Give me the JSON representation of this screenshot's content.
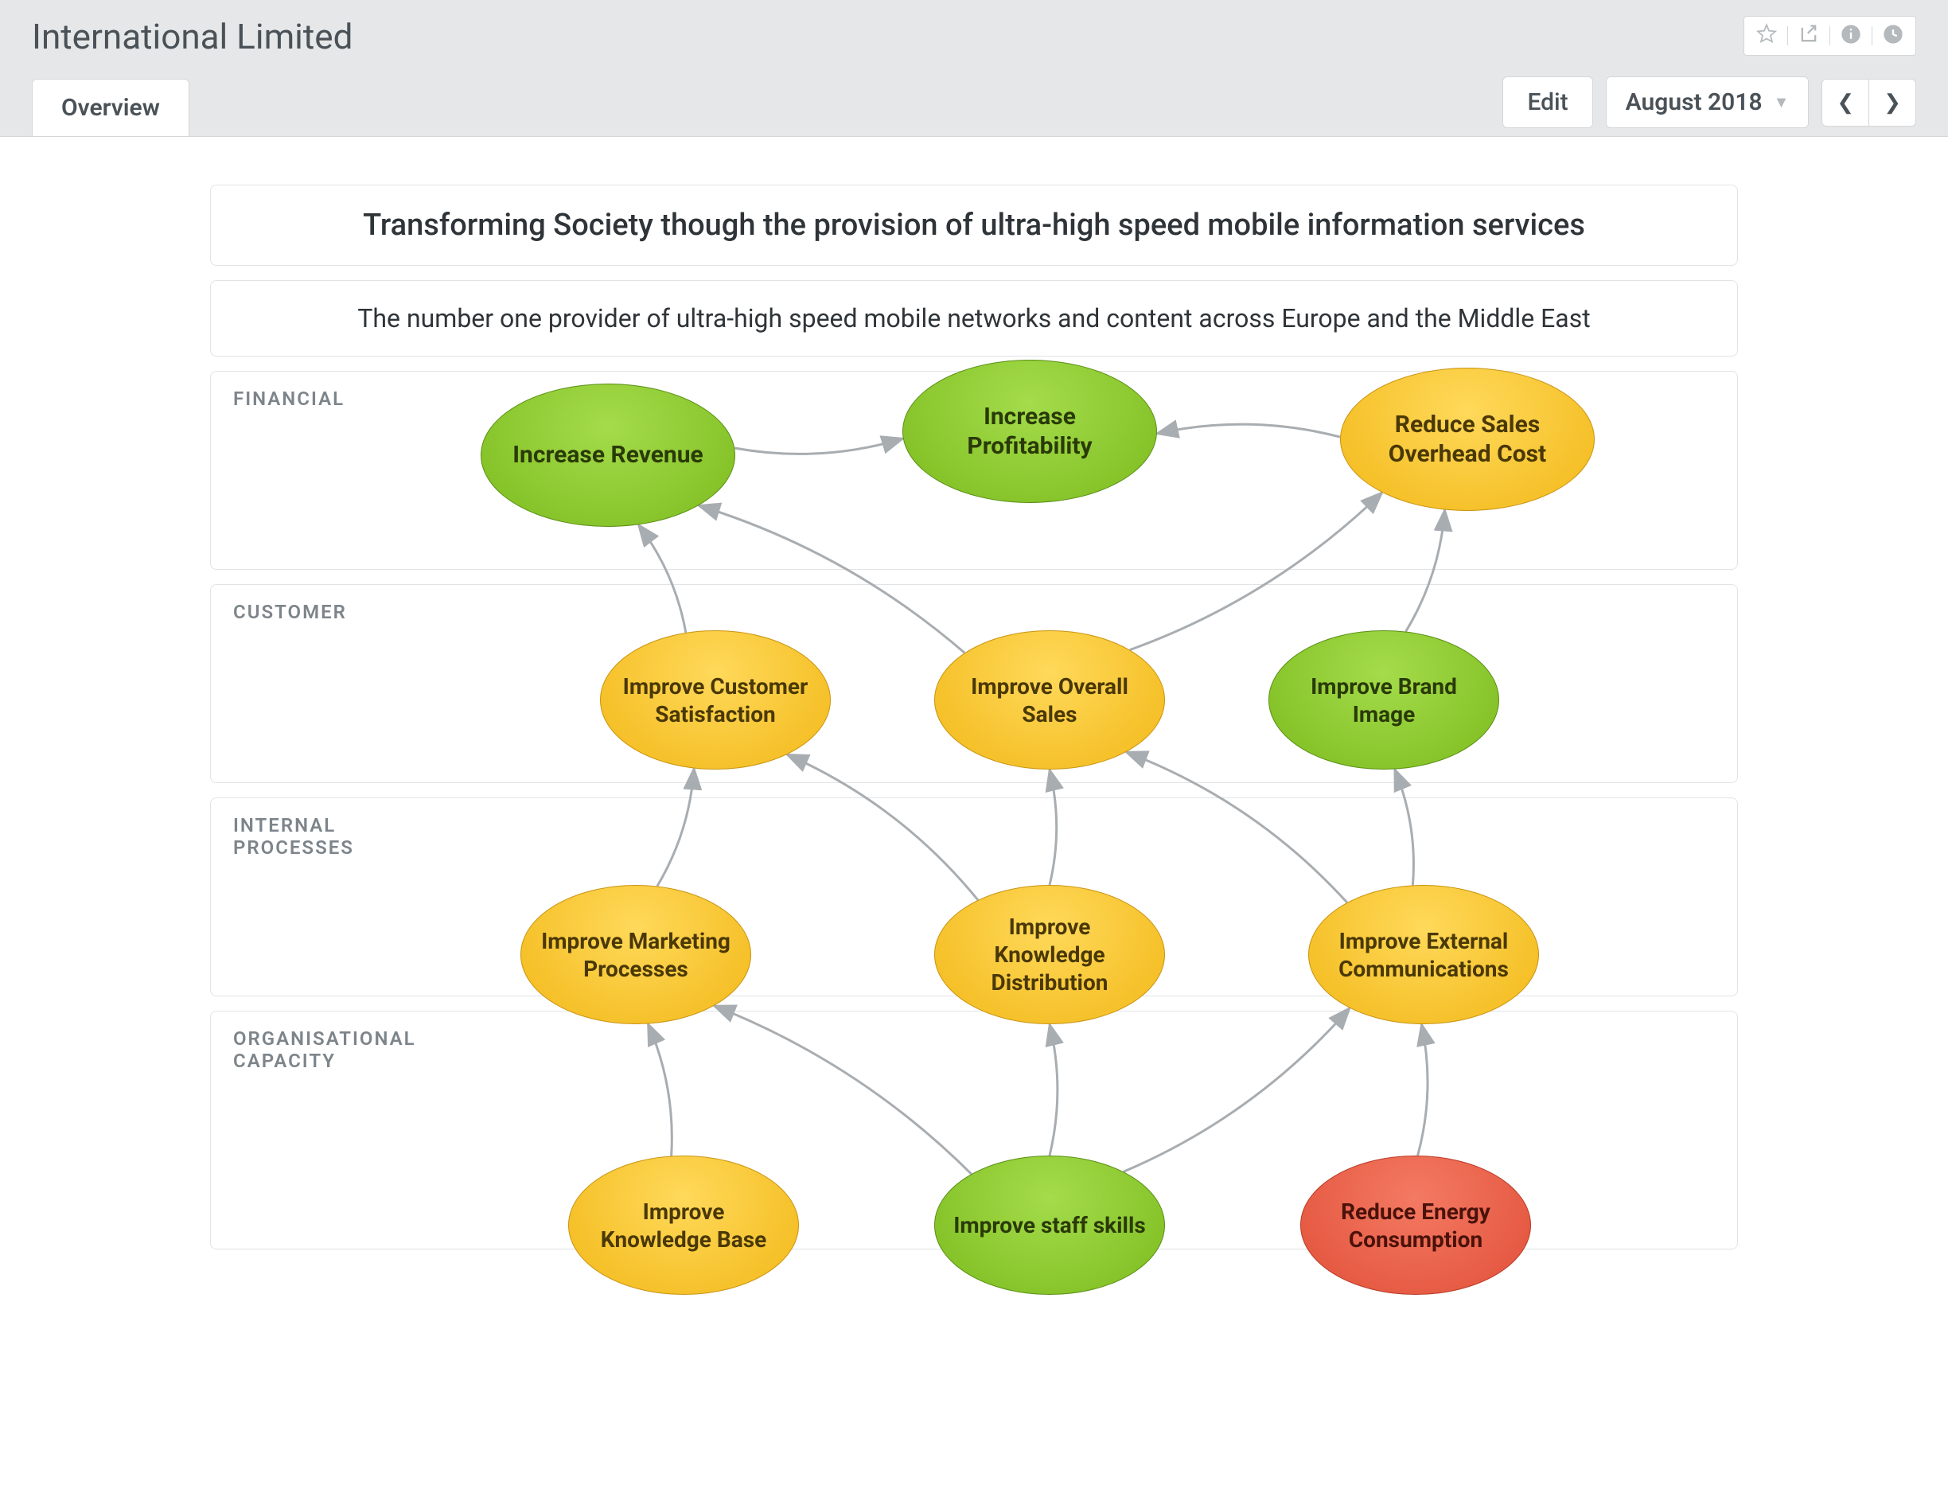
{
  "header": {
    "title": "International Limited"
  },
  "controls": {
    "tab_overview": "Overview",
    "edit_label": "Edit",
    "period_label": "August 2018"
  },
  "panels": {
    "mission": "Transforming Society though the provision of ultra-high speed mobile information services",
    "vision": "The number one provider of ultra-high speed mobile networks and content across Europe and the Middle East"
  },
  "perspectives": [
    {
      "id": "financial",
      "label": "FINANCIAL"
    },
    {
      "id": "customer",
      "label": "CUSTOMER"
    },
    {
      "id": "internal",
      "label": "INTERNAL PROCESSES"
    },
    {
      "id": "org",
      "label": "ORGANISATIONAL CAPACITY"
    }
  ],
  "nodes": {
    "increase_revenue": {
      "label": "Increase Revenue",
      "color": "green"
    },
    "increase_profitability": {
      "label": "Increase Profitability",
      "color": "green"
    },
    "reduce_sales_overhead": {
      "label": "Reduce Sales Overhead Cost",
      "color": "yellow"
    },
    "improve_customer_satisfaction": {
      "label": "Improve Customer Satisfaction",
      "color": "yellow"
    },
    "improve_overall_sales": {
      "label": "Improve Overall Sales",
      "color": "yellow"
    },
    "improve_brand_image": {
      "label": "Improve Brand Image",
      "color": "green"
    },
    "improve_marketing_processes": {
      "label": "Improve Marketing Processes",
      "color": "yellow"
    },
    "improve_knowledge_distribution": {
      "label": "Improve Knowledge Distribution",
      "color": "yellow"
    },
    "improve_external_communications": {
      "label": "Improve External Communications",
      "color": "yellow"
    },
    "improve_knowledge_base": {
      "label": "Improve Knowledge Base",
      "color": "yellow"
    },
    "improve_staff_skills": {
      "label": "Improve staff skills",
      "color": "green"
    },
    "reduce_energy_consumption": {
      "label": "Reduce Energy Consumption",
      "color": "red"
    }
  },
  "arrows": [
    {
      "from": "increase_revenue",
      "to": "increase_profitability"
    },
    {
      "from": "reduce_sales_overhead",
      "to": "increase_profitability"
    },
    {
      "from": "improve_customer_satisfaction",
      "to": "increase_revenue"
    },
    {
      "from": "improve_overall_sales",
      "to": "increase_revenue"
    },
    {
      "from": "improve_overall_sales",
      "to": "reduce_sales_overhead"
    },
    {
      "from": "improve_brand_image",
      "to": "reduce_sales_overhead"
    },
    {
      "from": "improve_marketing_processes",
      "to": "improve_customer_satisfaction"
    },
    {
      "from": "improve_knowledge_distribution",
      "to": "improve_customer_satisfaction"
    },
    {
      "from": "improve_knowledge_distribution",
      "to": "improve_overall_sales"
    },
    {
      "from": "improve_external_communications",
      "to": "improve_overall_sales"
    },
    {
      "from": "improve_external_communications",
      "to": "improve_brand_image"
    },
    {
      "from": "improve_knowledge_base",
      "to": "improve_marketing_processes"
    },
    {
      "from": "improve_staff_skills",
      "to": "improve_marketing_processes"
    },
    {
      "from": "improve_staff_skills",
      "to": "improve_knowledge_distribution"
    },
    {
      "from": "improve_staff_skills",
      "to": "improve_external_communications"
    },
    {
      "from": "reduce_energy_consumption",
      "to": "improve_external_communications"
    }
  ],
  "colors": {
    "green": "#8bc926",
    "yellow": "#f2b818",
    "red": "#e14f38"
  }
}
